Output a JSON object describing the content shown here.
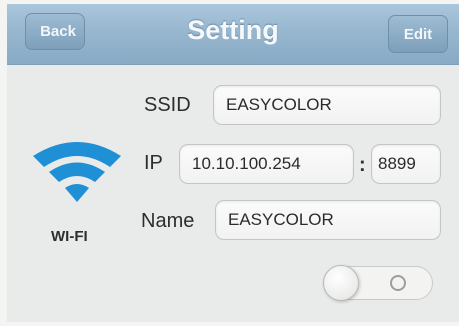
{
  "header": {
    "title": "Setting",
    "back_label": "Back",
    "edit_label": "Edit"
  },
  "wifi": {
    "icon": "wifi-icon",
    "label": "WI-FI"
  },
  "form": {
    "ssid_label": "SSID",
    "ssid_value": "EASYCOLOR",
    "ip_label": "IP",
    "ip_value": "10.10.100.254",
    "separator": ":",
    "port_value": "8899",
    "name_label": "Name",
    "name_value": "EASYCOLOR"
  },
  "toggle": {
    "state": "off"
  },
  "colors": {
    "titlebar": "#97b7cf",
    "button": "#8eaec6",
    "wifi_blue": "#1f8fd6",
    "background": "#e9ebea"
  }
}
